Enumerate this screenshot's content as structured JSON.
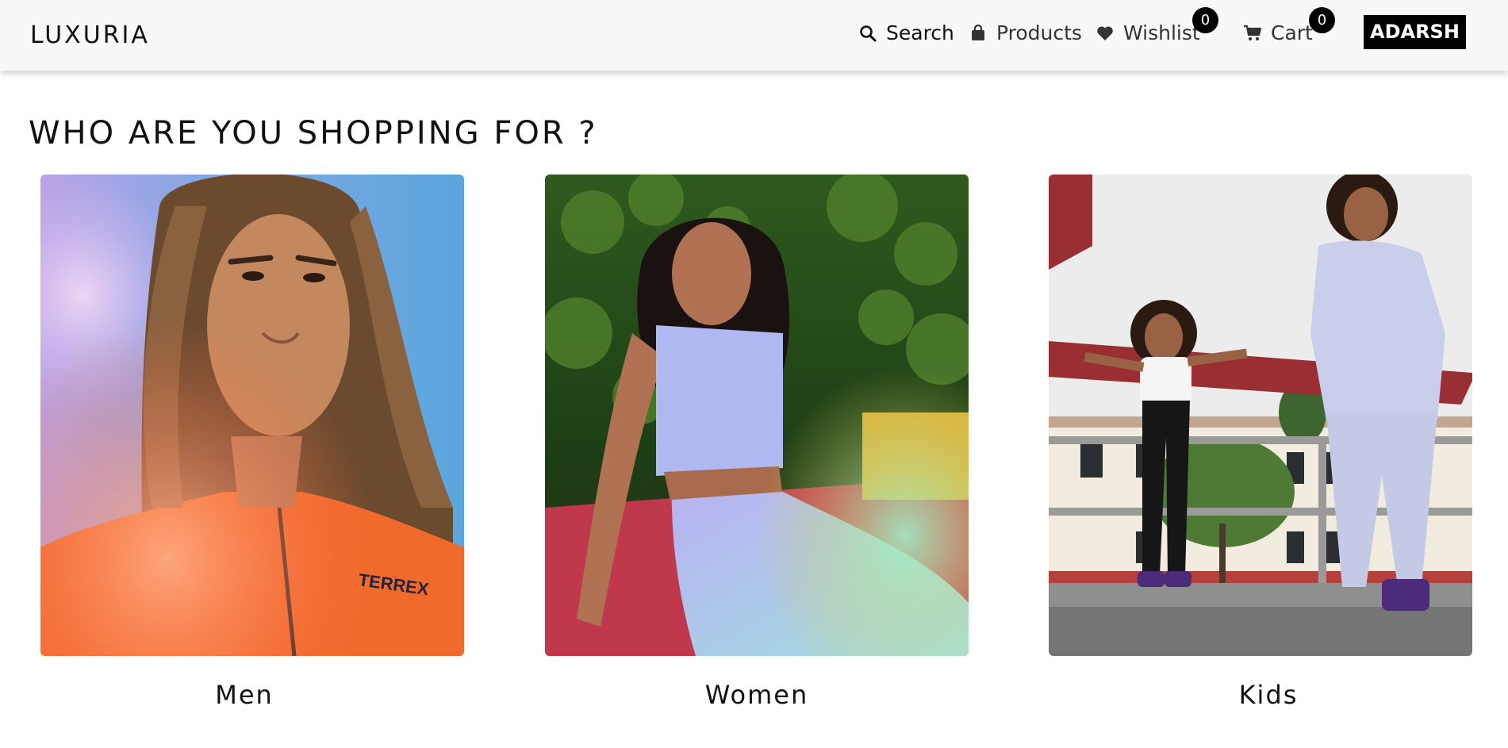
{
  "header": {
    "brand": "LUXURIA",
    "nav": {
      "search_label": "Search",
      "products_label": "Products",
      "wishlist_label": "Wishlist",
      "wishlist_count": "0",
      "cart_label": "Cart",
      "cart_count": "0"
    },
    "user_label": "ADARSH"
  },
  "main": {
    "title": "WHO ARE YOU SHOPPING FOR ?",
    "categories": [
      {
        "label": "Men",
        "image_icon": "photo-man-orange-jacket"
      },
      {
        "label": "Women",
        "image_icon": "photo-woman-lavender-set"
      },
      {
        "label": "Kids",
        "image_icon": "photo-kids-playground"
      }
    ]
  },
  "colors": {
    "header_bg": "#f8f8f8",
    "badge_bg": "#000000",
    "user_button_bg": "#000000",
    "text": "#111111"
  }
}
